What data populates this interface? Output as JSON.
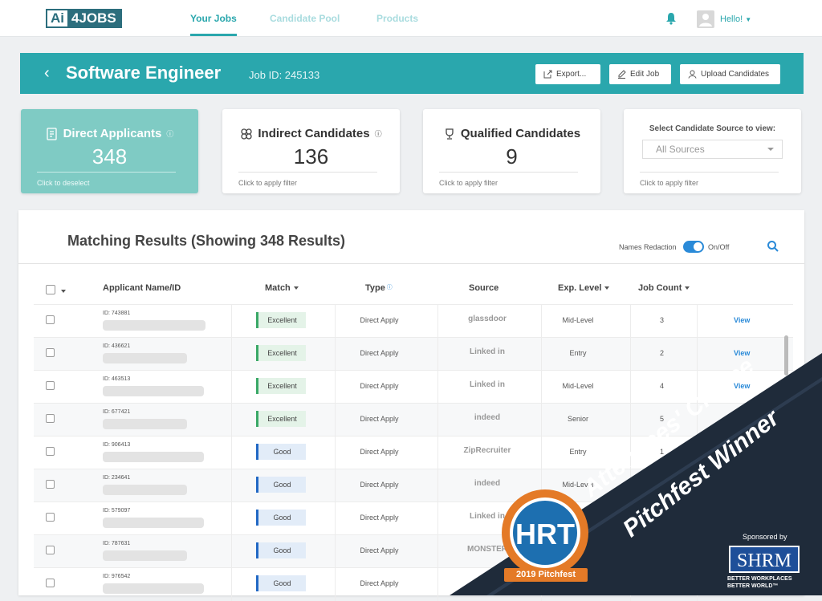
{
  "nav": {
    "logo_ai": "Ai",
    "logo_jobs": "4JOBS",
    "links": [
      "Your Jobs",
      "Candidate Pool",
      "Products"
    ],
    "greeting": "Hello!"
  },
  "job": {
    "title": "Software Engineer",
    "job_id": "Job ID: 245133",
    "export_label": "Export...",
    "edit_label": "Edit Job",
    "upload_label": "Upload Candidates"
  },
  "cards": [
    {
      "title": "Direct Applicants",
      "count": "348",
      "foot": "Click to deselect"
    },
    {
      "title": "Indirect Candidates",
      "count": "136",
      "foot": "Click to apply filter"
    },
    {
      "title": "Qualified Candidates",
      "count": "9",
      "foot": "Click to apply filter"
    }
  ],
  "source_card": {
    "label": "Select Candidate Source to view:",
    "selected": "All Sources",
    "foot": "Click to apply filter"
  },
  "results": {
    "title": "Matching Results (Showing 348 Results)",
    "redaction_label": "Names Redaction",
    "toggle_label": "On/Off",
    "headers": [
      "Applicant Name/ID",
      "Match",
      "Type",
      "Source",
      "Exp. Level",
      "Job Count"
    ]
  },
  "rows": [
    {
      "id": "ID: 743881",
      "match": "Excellent",
      "type": "Direct Apply",
      "source": "glassdoor",
      "exp": "Mid-Level",
      "count": "3",
      "view": "View"
    },
    {
      "id": "ID: 436621",
      "match": "Excellent",
      "type": "Direct Apply",
      "source": "Linked in",
      "exp": "Entry",
      "count": "2",
      "view": "View"
    },
    {
      "id": "ID: 463513",
      "match": "Excellent",
      "type": "Direct Apply",
      "source": "Linked in",
      "exp": "Mid-Level",
      "count": "4",
      "view": "View"
    },
    {
      "id": "ID: 677421",
      "match": "Excellent",
      "type": "Direct Apply",
      "source": "indeed",
      "exp": "Senior",
      "count": "5",
      "view": ""
    },
    {
      "id": "ID: 906413",
      "match": "Good",
      "type": "Direct Apply",
      "source": "ZipRecruiter",
      "exp": "Entry",
      "count": "1",
      "view": ""
    },
    {
      "id": "ID: 234641",
      "match": "Good",
      "type": "Direct Apply",
      "source": "indeed",
      "exp": "Mid-Level",
      "count": "",
      "view": ""
    },
    {
      "id": "ID: 579097",
      "match": "Good",
      "type": "Direct Apply",
      "source": "Linked in",
      "exp": "",
      "count": "",
      "view": ""
    },
    {
      "id": "ID: 787631",
      "match": "Good",
      "type": "Direct Apply",
      "source": "MONSTER",
      "exp": "",
      "count": "",
      "view": ""
    },
    {
      "id": "ID: 976542",
      "match": "Good",
      "type": "Direct Apply",
      "source": "",
      "exp": "",
      "count": "",
      "view": ""
    }
  ],
  "banner": {
    "line1": "Attendees' Choice",
    "line2": "Pitchfest Winner",
    "badge_text": "HRT",
    "badge_label": "2019 Pitchfest",
    "sponsor": "Sponsored by",
    "shrm": "SHRM",
    "shrm_tag1": "BETTER WORKPLACES",
    "shrm_tag2": "BETTER WORLD™"
  },
  "colors": {
    "teal": "#2aa7ad",
    "selected_card": "#7fcbc4",
    "banner": "#1f2b3a",
    "excellent": "#3aa867",
    "good": "#2168c4"
  }
}
